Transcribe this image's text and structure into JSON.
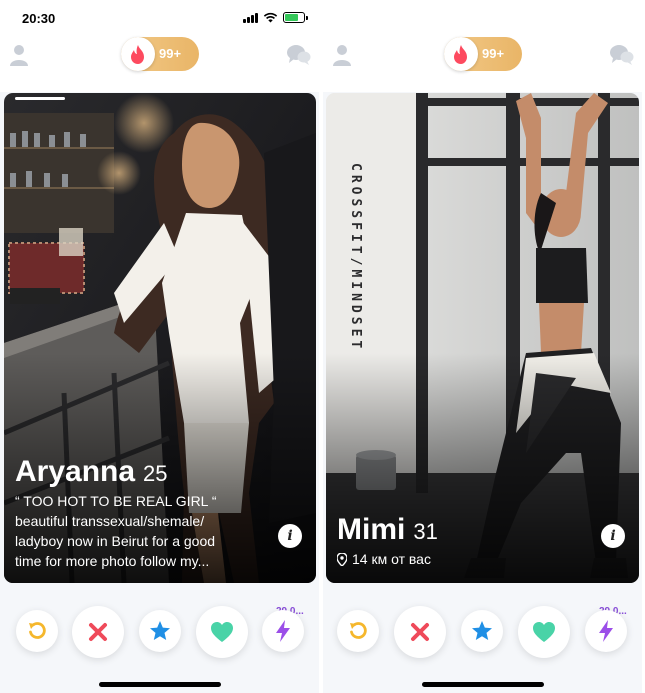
{
  "status": {
    "time": "20:30"
  },
  "header": {
    "super_count": "99+"
  },
  "cards": [
    {
      "name": "Aryanna",
      "age": "25",
      "bio_lines": [
        "“ TOO HOT TO BE REAL GIRL “",
        "beautiful transsexual/shemale/",
        "ladyboy now in Beirut for  a good",
        "time for more photo follow my..."
      ]
    },
    {
      "name": "Mimi",
      "age": "31",
      "distance": "14 км от вас",
      "wall_text": "CROSSFIT/MINDSET"
    }
  ],
  "actions": {
    "boost_count": "29,0...",
    "icons": [
      "rewind-icon",
      "nope-icon",
      "super-like-icon",
      "like-icon",
      "boost-icon"
    ]
  },
  "colors": {
    "rewind": "#f5b72c",
    "nope": "#ef4a5a",
    "super_like": "#1f8fe5",
    "like": "#49d3a7",
    "boost": "#9b4ee8",
    "flame": "#fd4a5f",
    "pill_gold": "#efc07a"
  }
}
